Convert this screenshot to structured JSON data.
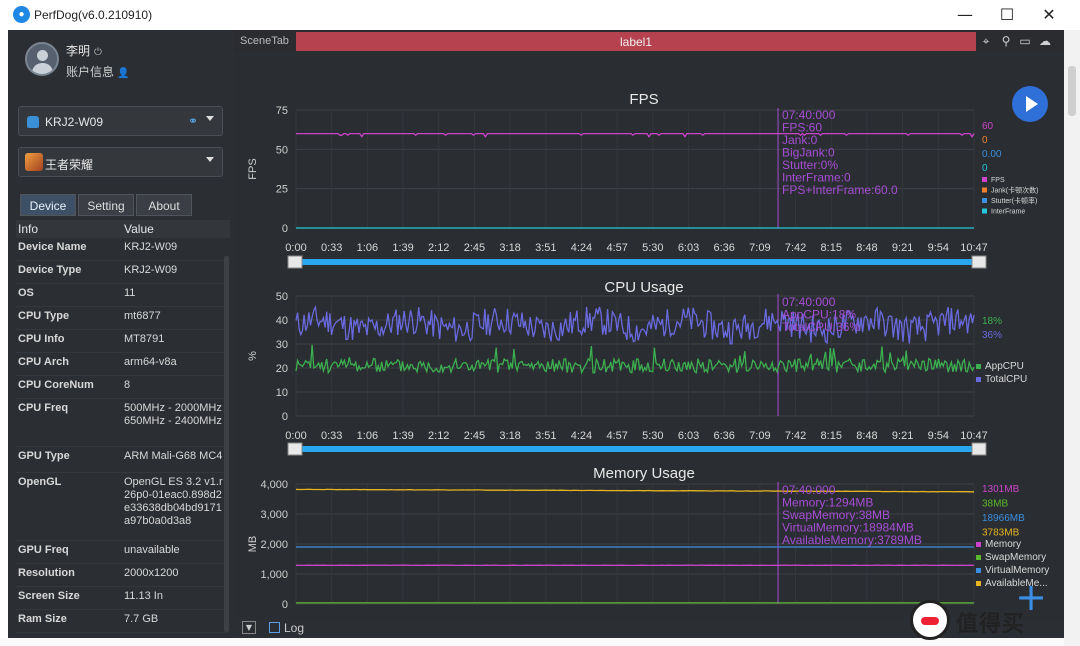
{
  "window": {
    "title": "PerfDog(v6.0.210910)",
    "controls": {
      "minimize": "—",
      "maximize": "☐",
      "close": "✕"
    }
  },
  "user": {
    "name": "李明",
    "account_label": "账户信息"
  },
  "device_select": {
    "value": "KRJ2-W09"
  },
  "app_select": {
    "value": "王者荣耀"
  },
  "tabs": [
    {
      "label": "Device",
      "active": true
    },
    {
      "label": "Setting",
      "active": false
    },
    {
      "label": "About",
      "active": false
    }
  ],
  "info_table": {
    "headers": [
      "Info",
      "Value"
    ],
    "rows": [
      {
        "key": "Device Name",
        "value": "KRJ2-W09"
      },
      {
        "key": "Device Type",
        "value": "KRJ2-W09"
      },
      {
        "key": "OS",
        "value": "11"
      },
      {
        "key": "CPU Type",
        "value": "mt6877"
      },
      {
        "key": "CPU Info",
        "value": "MT8791"
      },
      {
        "key": "CPU Arch",
        "value": "arm64-v8a"
      },
      {
        "key": "CPU CoreNum",
        "value": "8"
      },
      {
        "key": "CPU Freq",
        "value": "500MHz - 2000MHz 650MHz - 2400MHz"
      },
      {
        "key": "GPU Type",
        "value": "ARM Mali-G68 MC4"
      },
      {
        "key": "OpenGL",
        "value": "OpenGL ES 3.2 v1.r26p0-01eac0.898d2e33638db04bd9171a97b0a0d3a8"
      },
      {
        "key": "GPU Freq",
        "value": "unavailable"
      },
      {
        "key": "Resolution",
        "value": "2000x1200"
      },
      {
        "key": "Screen Size",
        "value": "11.13 In"
      },
      {
        "key": "Ram Size",
        "value": "7.7 GB"
      }
    ]
  },
  "scene": {
    "tab_label": "SceneTab",
    "label": "label1"
  },
  "toolbar_icons": [
    "location-pin-icon",
    "map-marker-icon",
    "folder-icon",
    "cloud-icon"
  ],
  "log_label": "Log",
  "x_ticks": [
    "0:00",
    "0:33",
    "1:06",
    "1:39",
    "2:12",
    "2:45",
    "3:18",
    "3:51",
    "4:24",
    "4:57",
    "5:30",
    "6:03",
    "6:36",
    "7:09",
    "7:42",
    "8:15",
    "8:48",
    "9:21",
    "9:54",
    "10:47"
  ],
  "cursor_time": "7:40",
  "colors": {
    "fps": "#cc44cc",
    "jank": "#f08030",
    "stutter": "#3a8fe0",
    "interframe": "#26c6da",
    "appcpu": "#3cb050",
    "totalcpu": "#6a6ae0",
    "memory": "#cc44cc",
    "swap": "#5cb82c",
    "virtual": "#3a8fe0",
    "available": "#e6b422",
    "tooltip": "#a64dd6",
    "slider": "#29a8f0",
    "label_bar": "#b5424e"
  },
  "chart_data": [
    {
      "type": "line",
      "title": "FPS",
      "ylabel": "FPS",
      "ylim": [
        0,
        75
      ],
      "yticks": [
        "75",
        "50",
        "25",
        "0"
      ],
      "series": [
        {
          "name": "FPS",
          "value_label": "60",
          "values_summary": "steady ~60 with small dips to ~59"
        },
        {
          "name": "Jank(卡顿次数)",
          "value_label": "0"
        },
        {
          "name": "Stutter(卡顿率)",
          "value_label": "0.00"
        },
        {
          "name": "InterFrame",
          "value_label": "0"
        }
      ],
      "tooltip": [
        "07:40:000",
        "FPS:60",
        "Jank:0",
        "BigJank:0",
        "Stutter:0%",
        "InterFrame:0",
        "FPS+InterFrame:60.0"
      ]
    },
    {
      "type": "line",
      "title": "CPU Usage",
      "ylabel": "%",
      "ylim": [
        0,
        50
      ],
      "yticks": [
        "50",
        "40",
        "30",
        "20",
        "10",
        "0"
      ],
      "series": [
        {
          "name": "AppCPU",
          "value_label": "18%",
          "mean": 21,
          "range": [
            16,
            30
          ]
        },
        {
          "name": "TotalCPU",
          "value_label": "36%",
          "mean": 38,
          "range": [
            30,
            48
          ]
        }
      ],
      "tooltip": [
        "07:40:000",
        "AppCPU:18%",
        "TotalCPU:36%"
      ]
    },
    {
      "type": "line",
      "title": "Memory Usage",
      "ylabel": "MB",
      "ylim": [
        0,
        4000
      ],
      "yticks": [
        "4,000",
        "3,000",
        "2,000",
        "1,000",
        "0"
      ],
      "series": [
        {
          "name": "Memory",
          "value_label": "1301MB",
          "mean": 1295
        },
        {
          "name": "SwapMemory",
          "value_label": "38MB",
          "mean": 38
        },
        {
          "name": "VirtualMemory",
          "value_label": "18966MB",
          "mean": 18984
        },
        {
          "name": "AvailableMe...",
          "value_label": "3783MB",
          "mean": 3790
        }
      ],
      "tooltip": [
        "07:40:000",
        "Memory:1294MB",
        "SwapMemory:38MB",
        "VirtualMemory:18984MB",
        "AvailableMemory:3789MB"
      ]
    }
  ],
  "watermark": {
    "text": "值得买"
  }
}
